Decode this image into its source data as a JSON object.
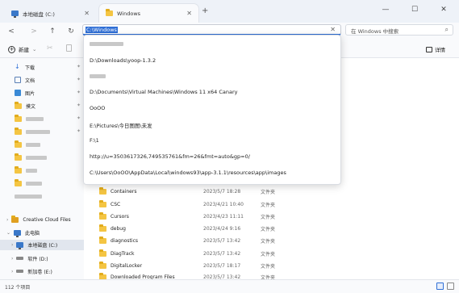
{
  "tabs": [
    {
      "label": "本地磁盘 (C:)"
    },
    {
      "label": "Windows"
    }
  ],
  "new_tab": "+",
  "window_controls": {
    "minimize": "—",
    "maximize": "☐",
    "close": "✕"
  },
  "nav": {
    "back": "<",
    "forward": ">",
    "up": "↑",
    "refresh": "↻"
  },
  "address": {
    "value": "C:\\Windows",
    "clear": "✕"
  },
  "search": {
    "placeholder": "在 Windows 中搜索"
  },
  "toolbar": {
    "new_label": "新建",
    "details_label": "详情"
  },
  "dropdown_items": [
    "",
    "D:\\Downloads\\yoop-1.3.2",
    "",
    "D:\\Documents\\Virtual Machines\\Windows 11 x64 Canary",
    "OoOO",
    "E:\\Pictures\\今日图图\\未发",
    "F:\\1",
    "http://u=3503617326,749535761&fm=26&fmt=auto&gp=0/",
    "C:\\Users\\OoOO\\AppData\\Local\\windows93\\app-3.1.1\\resources\\app\\images"
  ],
  "sidebar": {
    "quick": [
      {
        "label": "下载"
      },
      {
        "label": "文档"
      },
      {
        "label": "图片"
      },
      {
        "label": "摸文"
      }
    ],
    "tree": [
      {
        "label": "Creative Cloud Files"
      },
      {
        "label": "此电脑"
      },
      {
        "label": "本地磁盘 (C:)"
      },
      {
        "label": "软件 (D:)"
      },
      {
        "label": "新加卷 (E:)"
      }
    ]
  },
  "files": [
    {
      "name": "Containers",
      "date": "2023/5/7 18:28",
      "type": "文件夹"
    },
    {
      "name": "CSC",
      "date": "2023/4/21 10:40",
      "type": "文件夹"
    },
    {
      "name": "Cursors",
      "date": "2023/4/23 11:11",
      "type": "文件夹"
    },
    {
      "name": "debug",
      "date": "2023/4/24 9:16",
      "type": "文件夹"
    },
    {
      "name": "diagnostics",
      "date": "2023/5/7 13:42",
      "type": "文件夹"
    },
    {
      "name": "DiagTrack",
      "date": "2023/5/7 13:42",
      "type": "文件夹"
    },
    {
      "name": "DigitalLocker",
      "date": "2023/5/7 18:17",
      "type": "文件夹"
    },
    {
      "name": "Downloaded Program Files",
      "date": "2023/5/7 13:42",
      "type": "文件夹"
    }
  ],
  "status": {
    "count": "112 个项目"
  },
  "colors": {
    "accent": "#2f6fd6",
    "folder": "#f4c543"
  }
}
